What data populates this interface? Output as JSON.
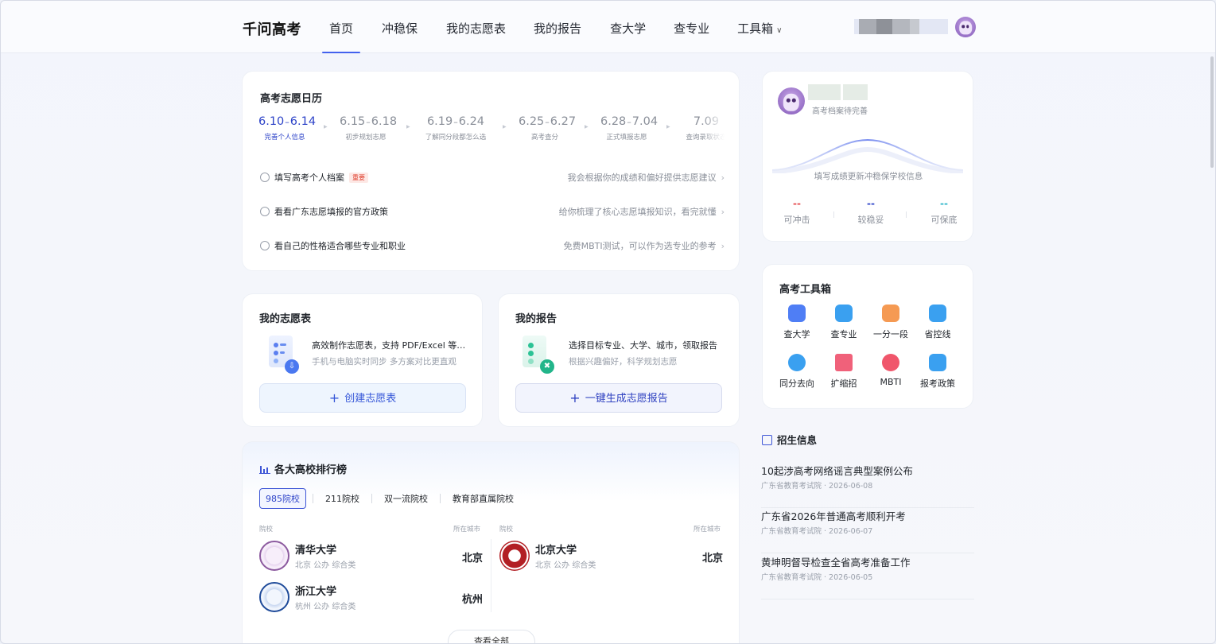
{
  "header": {
    "logo": "千问高考",
    "nav": [
      {
        "label": "首页",
        "active": true
      },
      {
        "label": "冲稳保"
      },
      {
        "label": "我的志愿表"
      },
      {
        "label": "我的报告"
      },
      {
        "label": "查大学"
      },
      {
        "label": "查专业"
      },
      {
        "label": "工具箱",
        "chevron": "chevron-down-icon"
      }
    ]
  },
  "calendar": {
    "title": "高考志愿日历",
    "stages": [
      {
        "start": "6.10",
        "end": "6.14",
        "sub": "完善个人信息",
        "active": true
      },
      {
        "start": "6.15",
        "end": "6.18",
        "sub": "初步规划志愿"
      },
      {
        "start": "6.19",
        "end": "6.24",
        "sub": "了解同分段都怎么选"
      },
      {
        "start": "6.25",
        "end": "6.27",
        "sub": "高考查分"
      },
      {
        "start": "6.28",
        "end": "7.04",
        "sub": "正式填报志愿"
      },
      {
        "start": "7.09",
        "end": "",
        "sub": "查询录取状态"
      }
    ],
    "tasks": [
      {
        "label": "填写高考个人档案",
        "tag": "重要",
        "desc": "我会根据你的成绩和偏好提供志愿建议"
      },
      {
        "label": "看看广东志愿填报的官方政策",
        "desc": "给你梳理了核心志愿填报知识，看完就懂"
      },
      {
        "label": "看自己的性格适合哪些专业和职业",
        "desc": "免费MBTI测试，可以作为选专业的参考"
      }
    ]
  },
  "wishlist": {
    "title": "我的志愿表",
    "line1": "高效制作志愿表，支持 PDF/Excel 等…",
    "line2": "手机与电脑实时同步 多方案对比更直观",
    "button": "创建志愿表",
    "plus": "+"
  },
  "report": {
    "title": "我的报告",
    "line1": "选择目标专业、大学、城市，领取报告",
    "line2": "根据兴趣偏好，科学规划志愿",
    "button": "一键生成志愿报告",
    "plus": "+"
  },
  "ranking": {
    "title": "各大高校排行榜",
    "tabs": [
      "985院校",
      "211院校",
      "双一流院校",
      "教育部直属院校"
    ],
    "col_school": "院校",
    "col_city": "所在城市",
    "left": [
      {
        "name": "清华大学",
        "meta": "北京 公办 综合类",
        "city": "北京"
      },
      {
        "name": "浙江大学",
        "meta": "杭州 公办 综合类",
        "city": "杭州"
      }
    ],
    "right": [
      {
        "name": "北京大学",
        "meta": "北京 公办 综合类",
        "city": "北京"
      }
    ],
    "more": "查看全部"
  },
  "profile": {
    "subtitle": "高考档案待完善",
    "hint": "填写成绩更新冲稳保学校信息",
    "stats": [
      {
        "value": "--",
        "label": "可冲击",
        "color": "#e5484d"
      },
      {
        "value": "--",
        "label": "较稳妥",
        "color": "#2d43c8"
      },
      {
        "value": "--",
        "label": "可保底",
        "color": "#2bb5c8"
      }
    ]
  },
  "toolbox": {
    "title": "高考工具箱",
    "items": [
      {
        "label": "查大学",
        "icon": "building-icon",
        "color": "#4f7ef5"
      },
      {
        "label": "查专业",
        "icon": "book-icon",
        "color": "#3aa0f0"
      },
      {
        "label": "一分一段",
        "icon": "score-icon",
        "color": "#f59a53"
      },
      {
        "label": "省控线",
        "icon": "monitor-icon",
        "color": "#3aa0f0"
      },
      {
        "label": "同分去向",
        "icon": "send-icon",
        "color": "#3aa0f0"
      },
      {
        "label": "扩缩招",
        "icon": "document-plus-icon",
        "color": "#f0617a"
      },
      {
        "label": "MBTI",
        "icon": "smile-icon",
        "color": "#f0566b"
      },
      {
        "label": "报考政策",
        "icon": "checkbox-icon",
        "color": "#3aa0f0"
      }
    ]
  },
  "news": {
    "title": "招生信息",
    "items": [
      {
        "title": "10起涉高考网络谣言典型案例公布",
        "meta": "广东省教育考试院 · 2026-06-08"
      },
      {
        "title": "广东省2026年普通高考顺利开考",
        "meta": "广东省教育考试院 · 2026-06-07"
      },
      {
        "title": "黄坤明督导检查全省高考准备工作",
        "meta": "广东省教育考试院 · 2026-06-05"
      }
    ]
  }
}
